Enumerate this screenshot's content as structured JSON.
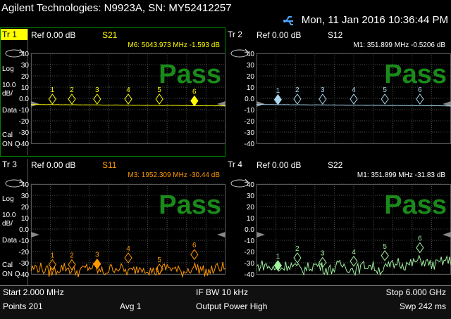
{
  "instrument": {
    "title": "Agilent Technologies: N9923A, SN: MY52412257",
    "datetime": "Mon, 11 Jan 2016 10:36:44 PM",
    "usb_icon": "usb-icon"
  },
  "traces": [
    {
      "id": "tr1",
      "tr_label": "Tr 1",
      "active": true,
      "param": "S21",
      "ref": "Ref 0.00 dB",
      "marker_readout": "M6: 5043.973 MHz  -1.593 dB",
      "readout_color": "#ffff00",
      "trace_color": "#ffff00",
      "param_color": "#ffff00",
      "result": "Pass",
      "format_label": "Log",
      "scale": "10.0",
      "scale_unit": "dB/",
      "data_label": "Data",
      "cal_label": "Cal",
      "cal_status": "ON Q",
      "markers": [
        {
          "num": "1",
          "level": 0
        },
        {
          "num": "2",
          "level": 0
        },
        {
          "num": "3",
          "level": 0
        },
        {
          "num": "4",
          "level": 0
        },
        {
          "num": "5",
          "level": 0
        },
        {
          "num": "6",
          "level": -1.6,
          "active": true
        }
      ]
    },
    {
      "id": "tr2",
      "tr_label": "Tr 2",
      "active": false,
      "param": "S12",
      "ref": "Ref 0.00 dB",
      "marker_readout": "M1: 351.899 MHz  -0.5206 dB",
      "readout_color": "#ffffff",
      "trace_color": "#a8d8f0",
      "param_color": "#ffffff",
      "result": "Pass",
      "markers": [
        {
          "num": "1",
          "level": -0.5,
          "active": true
        },
        {
          "num": "2",
          "level": 0
        },
        {
          "num": "3",
          "level": 0
        },
        {
          "num": "4",
          "level": 0
        },
        {
          "num": "5",
          "level": 0
        },
        {
          "num": "6",
          "level": 0
        }
      ]
    },
    {
      "id": "tr3",
      "tr_label": "Tr 3",
      "active": false,
      "param": "S11",
      "ref": "Ref 0.00 dB",
      "marker_readout": "M3: 1952.309 MHz  -30.44 dB",
      "readout_color": "#ff9900",
      "trace_color": "#ff9900",
      "param_color": "#ff9900",
      "result": "Pass",
      "format_label": "Log",
      "scale": "10.0",
      "scale_unit": "dB/",
      "data_label": "Data",
      "cal_label": "Cal",
      "cal_status": "ON Q",
      "markers": [
        {
          "num": "1",
          "level": -31
        },
        {
          "num": "2",
          "level": -31
        },
        {
          "num": "3",
          "level": -30.4,
          "active": true
        },
        {
          "num": "4",
          "level": -25
        },
        {
          "num": "5",
          "level": -35
        },
        {
          "num": "6",
          "level": -22
        }
      ]
    },
    {
      "id": "tr4",
      "tr_label": "Tr 4",
      "active": false,
      "param": "S22",
      "ref": "Ref 0.00 dB",
      "marker_readout": "M1: 351.899 MHz  -31.83 dB",
      "readout_color": "#ffffff",
      "trace_color": "#9ff09f",
      "param_color": "#ffffff",
      "result": "Pass",
      "markers": [
        {
          "num": "1",
          "level": -31.8,
          "active": true
        },
        {
          "num": "2",
          "level": -25
        },
        {
          "num": "3",
          "level": -29
        },
        {
          "num": "4",
          "level": -28
        },
        {
          "num": "5",
          "level": -23
        },
        {
          "num": "6",
          "level": -16
        }
      ]
    }
  ],
  "y_axis": {
    "ticks": [
      "40",
      "30",
      "20",
      "10",
      "0.0",
      "-10",
      "-20",
      "-30",
      "-40"
    ]
  },
  "footer": {
    "start": "Start 2.000 MHz",
    "ifbw": "IF BW 10 kHz",
    "stop": "Stop 6.000 GHz",
    "points": "Points 201",
    "avg": "Avg  1",
    "power": "Output Power High",
    "sweep": "Swp 242 ms"
  },
  "colors": {
    "grid": "#3a3a3a",
    "grid_dots": "#4d4d4d",
    "frame": "#9a9a9a",
    "active_border": "#008000",
    "pass": "#1a8a1a",
    "header_bg": "#1a1a1a",
    "footer_bg": "#101010",
    "tr_active_bg": "#ffff00"
  }
}
